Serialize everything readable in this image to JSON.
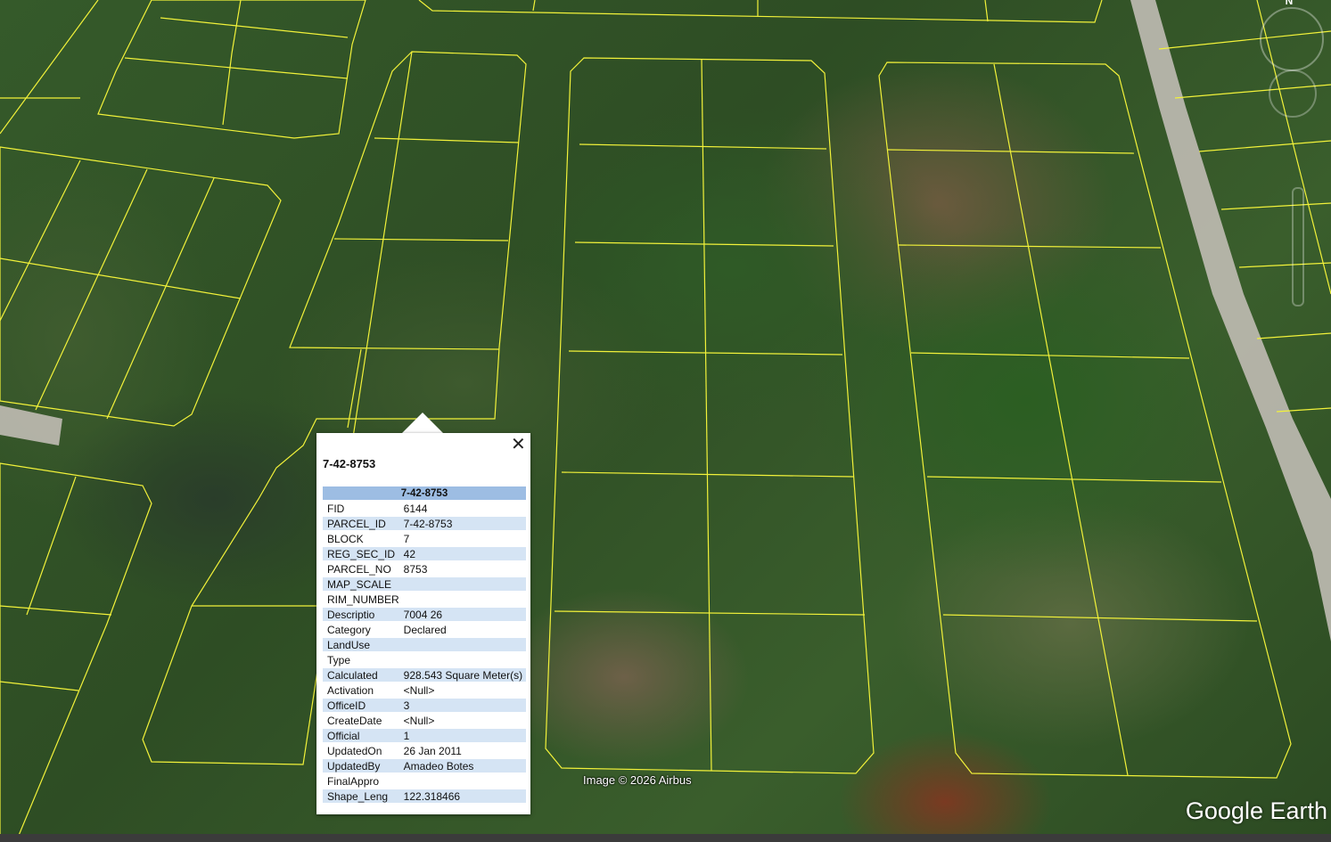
{
  "popup": {
    "title": "7-42-8753",
    "table_header": "7-42-8753",
    "close_glyph": "✕",
    "rows": [
      {
        "key": "FID",
        "value": "6144"
      },
      {
        "key": "PARCEL_ID",
        "value": "7-42-8753"
      },
      {
        "key": "BLOCK",
        "value": "7"
      },
      {
        "key": "REG_SEC_ID",
        "value": "42"
      },
      {
        "key": "PARCEL_NO",
        "value": "8753"
      },
      {
        "key": "MAP_SCALE",
        "value": ""
      },
      {
        "key": "RIM_NUMBER",
        "value": ""
      },
      {
        "key": "Descriptio",
        "value": "7004 26"
      },
      {
        "key": "Category",
        "value": "Declared"
      },
      {
        "key": "LandUse",
        "value": ""
      },
      {
        "key": "Type",
        "value": ""
      },
      {
        "key": "Calculated",
        "value": "928.543 Square Meter(s)"
      },
      {
        "key": "Activation",
        "value": "<Null>"
      },
      {
        "key": "OfficeID",
        "value": "3"
      },
      {
        "key": "CreateDate",
        "value": "<Null>"
      },
      {
        "key": "Official",
        "value": "1"
      },
      {
        "key": "UpdatedOn",
        "value": "26 Jan 2011"
      },
      {
        "key": "UpdatedBy",
        "value": "Amadeo Botes"
      },
      {
        "key": "FinalAppro",
        "value": ""
      },
      {
        "key": "Shape_Leng",
        "value": "122.318466"
      }
    ]
  },
  "map": {
    "attribution": "Image © 2026 Airbus",
    "logo": "Google Earth",
    "compass_north": "N",
    "parcel_line_color": "#f2f23a",
    "road_color": "#b9b7ad"
  }
}
